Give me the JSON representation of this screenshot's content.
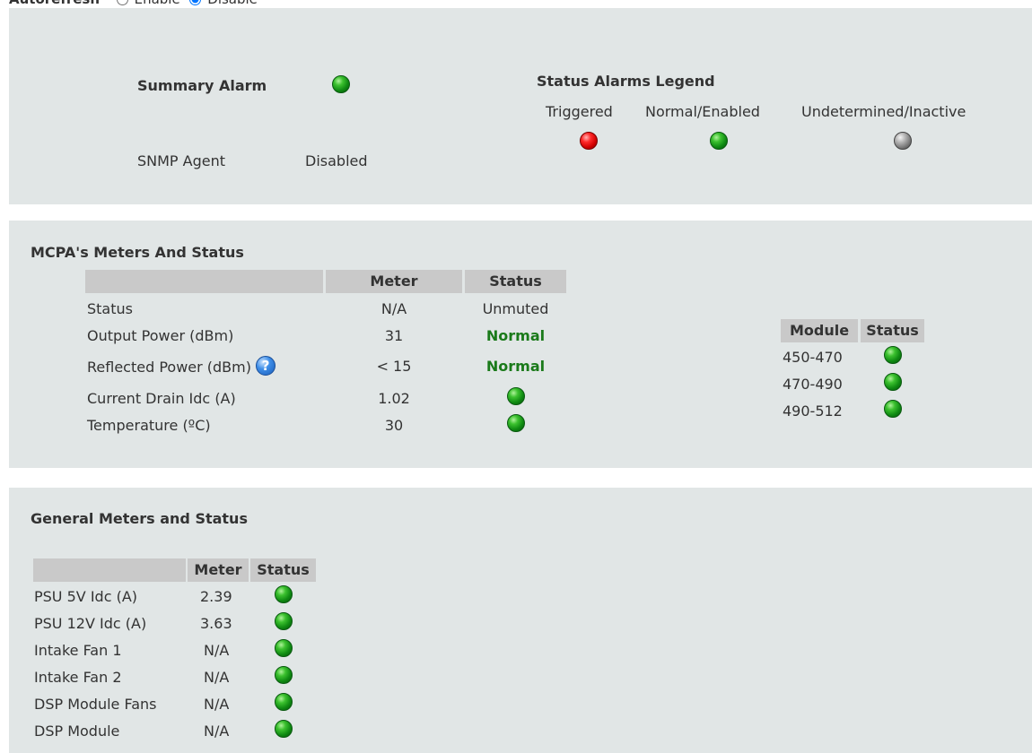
{
  "autorefresh": {
    "label": "Autorefresh",
    "enable_label": "Enable",
    "disable_label": "Disable"
  },
  "summary": {
    "summary_alarm_label": "Summary Alarm",
    "snmp_label": "SNMP Agent",
    "snmp_value": "Disabled",
    "legend_title": "Status Alarms Legend",
    "legend": [
      {
        "label": "Triggered",
        "color": "red"
      },
      {
        "label": "Normal/Enabled",
        "color": "green"
      },
      {
        "label": "Undetermined/Inactive",
        "color": "grey"
      }
    ]
  },
  "mcpa": {
    "title": "MCPA's Meters And Status",
    "col_meter": "Meter",
    "col_status": "Status",
    "rows": [
      {
        "label": "Status",
        "meter": "N/A",
        "status": "Unmuted"
      },
      {
        "label": "Output Power (dBm)",
        "meter": "31",
        "status": "Normal"
      },
      {
        "label": "Reflected Power (dBm)",
        "meter": "< 15",
        "status": "Normal"
      },
      {
        "label": "Current Drain Idc (A)",
        "meter": "1.02",
        "status": ""
      },
      {
        "label": "Temperature (ºC)",
        "meter": "30",
        "status": ""
      }
    ],
    "help_glyph": "?",
    "module_col": "Module",
    "module_status_col": "Status",
    "modules": [
      {
        "label": "450-470"
      },
      {
        "label": "470-490"
      },
      {
        "label": "490-512"
      }
    ]
  },
  "general": {
    "title": "General Meters and Status",
    "col_meter": "Meter",
    "col_status": "Status",
    "rows": [
      {
        "label": "PSU 5V Idc (A)",
        "meter": "2.39"
      },
      {
        "label": "PSU 12V Idc (A)",
        "meter": "3.63"
      },
      {
        "label": "Intake Fan 1",
        "meter": "N/A"
      },
      {
        "label": "Intake Fan 2",
        "meter": "N/A"
      },
      {
        "label": "DSP Module Fans",
        "meter": "N/A"
      },
      {
        "label": "DSP Module",
        "meter": "N/A"
      }
    ]
  },
  "colors": {
    "panel_bg": "#e1e6e6",
    "header_bg": "#c9c9c9",
    "normal_text": "#1a7a1a"
  }
}
